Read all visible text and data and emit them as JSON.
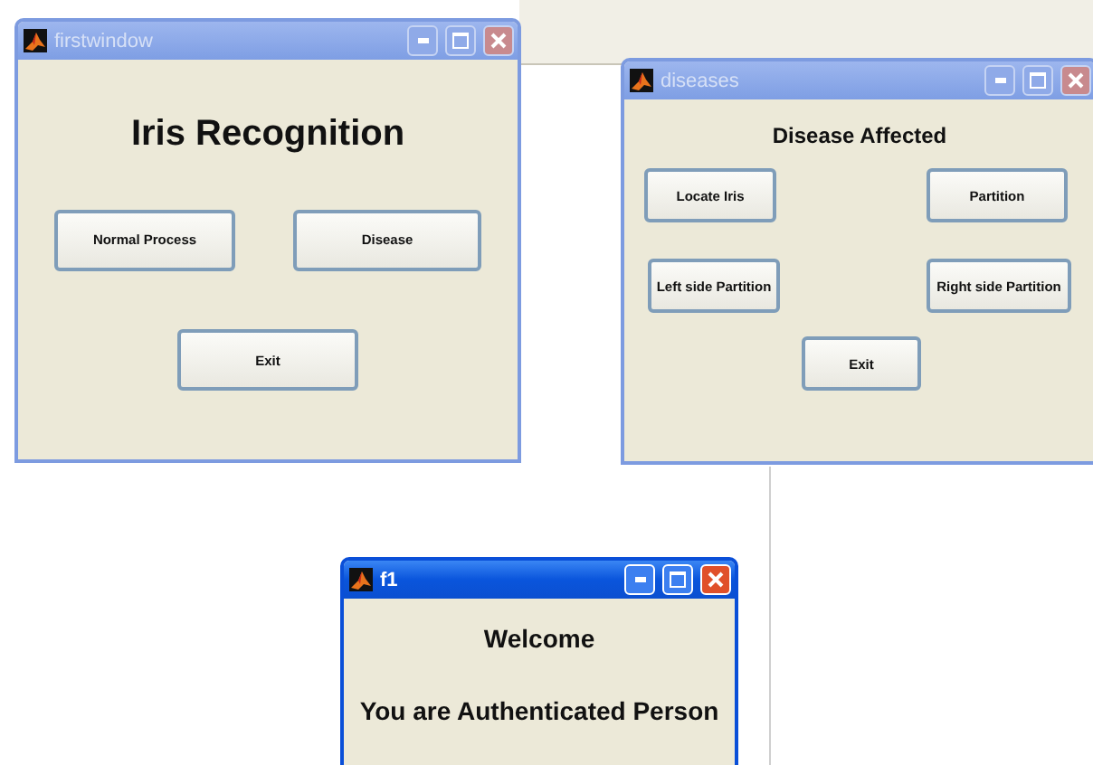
{
  "windows": [
    {
      "title": "firstwindow",
      "active": false,
      "texts": [
        "Iris Recognition"
      ],
      "button_rows": [
        [
          "Normal Process",
          "Disease"
        ],
        [
          "Exit"
        ]
      ]
    },
    {
      "title": "diseases",
      "active": false,
      "texts": [
        "Disease Affected"
      ],
      "button_rows": [
        [
          "Locate Iris",
          "Partition"
        ],
        [
          "Left side Partition",
          "Right side Partition"
        ],
        [
          "Exit"
        ]
      ]
    },
    {
      "title": "f1",
      "active": true,
      "texts": [
        "Welcome",
        "You are Authenticated Person"
      ]
    }
  ]
}
